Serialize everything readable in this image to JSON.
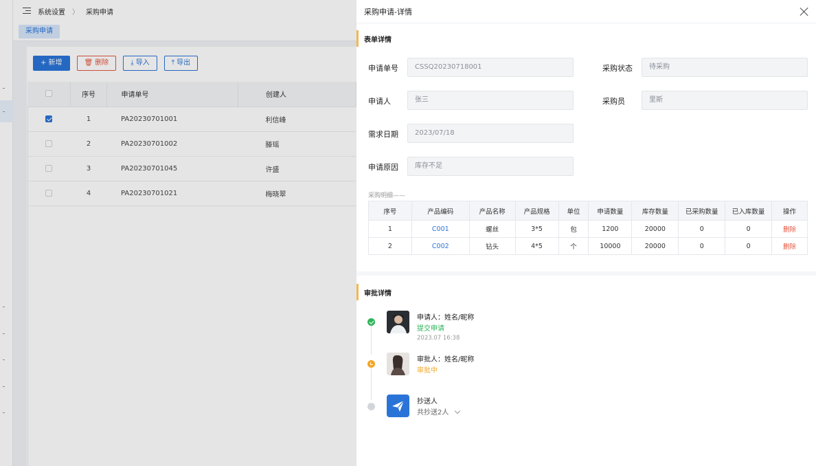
{
  "background": {
    "breadcrumb": {
      "home": "系统设置",
      "current": "采购申请"
    },
    "tab": "采购申请",
    "toolbar": {
      "add": "+ 新增",
      "delete": "删除",
      "import": "导入",
      "export": "导出"
    },
    "table": {
      "headers": [
        "序号",
        "申请单号",
        "创建人"
      ],
      "rows": [
        {
          "checked": true,
          "idx": "1",
          "no": "PA20230701001",
          "creator": "利信峰"
        },
        {
          "checked": false,
          "idx": "2",
          "no": "PA20230701002",
          "creator": "滕瑶"
        },
        {
          "checked": false,
          "idx": "3",
          "no": "PA20230701045",
          "creator": "许盛"
        },
        {
          "checked": false,
          "idx": "4",
          "no": "PA20230701021",
          "creator": "梅晓翠"
        }
      ]
    }
  },
  "drawer": {
    "title": "采购申请-详情",
    "form_section": "表单详情",
    "fields": {
      "apply_no_label": "申请单号",
      "apply_no": "CSSQ20230718001",
      "status_label": "采购状态",
      "status": "待采购",
      "applicant_label": "申请人",
      "applicant": "张三",
      "buyer_label": "采购员",
      "buyer": "里斯",
      "date_label": "需求日期",
      "date": "2023/07/18",
      "reason_label": "申请原因",
      "reason": "库存不足"
    },
    "detail_caption": "采购明细——",
    "detail_headers": [
      "序号",
      "产品编码",
      "产品名称",
      "产品规格",
      "单位",
      "申请数量",
      "库存数量",
      "已采购数量",
      "已入库数量",
      "操作"
    ],
    "detail_rows": [
      {
        "idx": "1",
        "code": "C001",
        "name": "螺丝",
        "spec": "3*5",
        "unit": "包",
        "qty": "1200",
        "stock": "20000",
        "purchased": "0",
        "stored": "0",
        "op": "删除"
      },
      {
        "idx": "2",
        "code": "C002",
        "name": "钻头",
        "spec": "4*5",
        "unit": "个",
        "qty": "10000",
        "stock": "20000",
        "purchased": "0",
        "stored": "0",
        "op": "删除"
      }
    ],
    "approval_section": "审批详情",
    "timeline": [
      {
        "name": "申请人：姓名/昵称",
        "status": "提交申请",
        "status_color": "#2fb45a",
        "time": "2023.07 16:38"
      },
      {
        "name": "审批人：姓名/昵称",
        "status": "审批中",
        "status_color": "#f5a623"
      },
      {
        "name": "抄送人",
        "status": "共抄送2人",
        "status_color": "#666666"
      }
    ]
  }
}
